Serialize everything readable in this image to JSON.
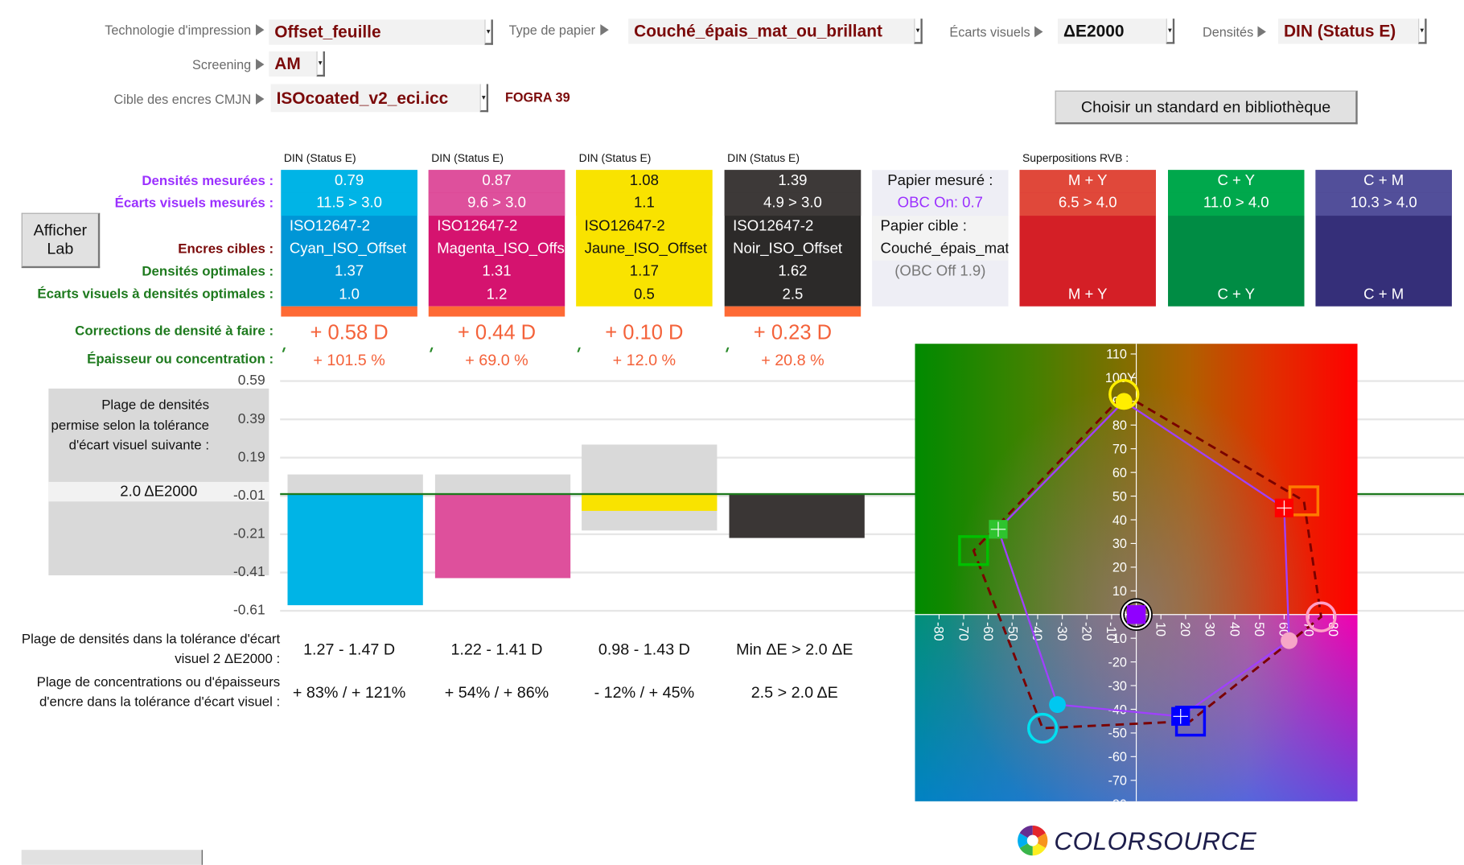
{
  "settings": {
    "technology": {
      "label": "Technologie d'impression",
      "value": "Offset_feuille"
    },
    "paper_type": {
      "label": "Type de papier",
      "value": "Couché_épais_mat_ou_brillant"
    },
    "visual_diff": {
      "label": "Écarts visuels",
      "value": "ΔE2000"
    },
    "densities": {
      "label": "Densités",
      "value": "DIN (Status E)"
    },
    "screening": {
      "label": "Screening",
      "value": "AM"
    },
    "target": {
      "label": "Cible des encres CMJN",
      "value": "ISOcoated_v2_eci.icc",
      "note": "FOGRA 39"
    },
    "library_button": "Choisir un standard en bibliothèque"
  },
  "show_lab_button": "Afficher Lab",
  "row_labels": {
    "measured_density": "Densités mesurées :",
    "measured_de": "Écarts visuels mesurés :",
    "target_inks": "Encres cibles :",
    "optimal_density": "Densités optimales :",
    "optimal_de": "Écarts visuels à densités optimales :",
    "corrections": "Corrections de densité à faire :",
    "thickness": "Épaisseur ou concentration :",
    "density_range": "Plage de densités dans la tolérance d'écart visuel 2 ΔE2000 :",
    "concentration_range": "Plage de concentrations ou d'épaisseurs d'encre dans la tolérance d'écart visuel :"
  },
  "inks": [
    {
      "header": "DIN (Status E)",
      "measured_density": "0.79",
      "measured_de": "11.5 > 3.0",
      "standard": "ISO12647-2",
      "ink_name": "Cyan_ISO_Offset",
      "optimal_density": "1.37",
      "optimal_de": "1.0",
      "correction": "+ 0.58 D",
      "thickness": "+ 101.5 %",
      "density_range": "1.27 - 1.47 D",
      "concentration_range": "+ 83% / + 121%",
      "color_top": "#00b4e6",
      "color_bottom": "#0096d6",
      "text_color": "#ffffff",
      "out_of_tolerance": true
    },
    {
      "header": "DIN (Status E)",
      "measured_density": "0.87",
      "measured_de": "9.6 > 3.0",
      "standard": "ISO12647-2",
      "ink_name": "Magenta_ISO_Offset",
      "optimal_density": "1.31",
      "optimal_de": "1.2",
      "correction": "+ 0.44 D",
      "thickness": "+ 69.0 %",
      "density_range": "1.22 - 1.41 D",
      "concentration_range": "+ 54% / + 86%",
      "color_top": "#de509c",
      "color_bottom": "#d5136f",
      "text_color": "#ffffff",
      "out_of_tolerance": true
    },
    {
      "header": "DIN (Status E)",
      "measured_density": "1.08",
      "measured_de": "1.1",
      "standard": "ISO12647-2",
      "ink_name": "Jaune_ISO_Offset",
      "optimal_density": "1.17",
      "optimal_de": "0.5",
      "correction": "+ 0.10 D",
      "thickness": "+ 12.0 %",
      "density_range": "0.98 - 1.43 D",
      "concentration_range": "- 12% / + 45%",
      "color_top": "#f9e300",
      "color_bottom": "#f9e300",
      "text_color": "#111111",
      "out_of_tolerance": false
    },
    {
      "header": "DIN (Status E)",
      "measured_density": "1.39",
      "measured_de": "4.9 > 3.0",
      "standard": "ISO12647-2",
      "ink_name": "Noir_ISO_Offset",
      "optimal_density": "1.62",
      "optimal_de": "2.5",
      "correction": "+ 0.23 D",
      "thickness": "+ 20.8 %",
      "density_range": "Min ΔE > 2.0 ΔE",
      "concentration_range": "2.5 > 2.0 ΔE",
      "color_top": "#3d3938",
      "color_bottom": "#2c2a29",
      "text_color": "#ffffff",
      "out_of_tolerance": true
    }
  ],
  "paper": {
    "measured_label": "Papier mesuré :",
    "measured_value": "OBC On: 0.7",
    "target_label": "Papier cible :",
    "target_value": "Couché_épais_mat_ou_brillant",
    "target_note": "(OBC Off 1.9)"
  },
  "overlays": {
    "title": "Superpositions RVB :",
    "items": [
      {
        "name": "M + Y",
        "de": "6.5 > 4.0",
        "color_top": "#e0483a",
        "color_bottom": "#d41f26"
      },
      {
        "name": "C + Y",
        "de": "11.0 > 4.0",
        "color_top": "#00a84c",
        "color_bottom": "#008c44"
      },
      {
        "name": "C + M",
        "de": "10.3 > 4.0",
        "color_top": "#524f9a",
        "color_bottom": "#352f79"
      }
    ]
  },
  "tolerance_box": {
    "text": "Plage de densités permise selon la tolérance d'écart visuel suivante :",
    "value": "2.0 ΔE2000"
  },
  "chart_data": [
    {
      "type": "bar",
      "categories": [
        "Cyan",
        "Magenta",
        "Jaune",
        "Noir"
      ],
      "series": [
        {
          "values": [
            -0.58,
            -0.44,
            -0.09,
            -0.23
          ],
          "colors": [
            "#00b4e6",
            "#de509c",
            "#f9e300",
            "#3a3635"
          ]
        }
      ],
      "tolerance_bands": [
        [
          -0.1,
          0.1
        ],
        [
          -0.09,
          0.1
        ],
        [
          -0.19,
          0.26
        ],
        null
      ],
      "band_color": "#d9d9d9",
      "reference_line": 0,
      "reference_color": "#1e7a1e",
      "yticks": [
        "0.59",
        "0.39",
        "0.19",
        "-0.01",
        "-0.21",
        "-0.41",
        "-0.61"
      ],
      "ylim": [
        -0.61,
        0.59
      ],
      "grid": true
    },
    {
      "type": "scatter",
      "xlim": [
        -90,
        90
      ],
      "ylim": [
        -80,
        115
      ],
      "xticks": [
        -80,
        -70,
        -60,
        -50,
        -40,
        -30,
        -20,
        -10,
        10,
        20,
        30,
        40,
        50,
        60,
        70,
        80
      ],
      "yticks": [
        110,
        100,
        90,
        80,
        70,
        60,
        50,
        40,
        30,
        20,
        10,
        0,
        -10,
        -20,
        -30,
        -40,
        -50,
        -60,
        -70,
        -80
      ],
      "axis_label_y": "Y",
      "measured": [
        {
          "ink": "Y",
          "a": -5,
          "b": 90,
          "color": "#ffee00",
          "marker": "circle"
        },
        {
          "ink": "R",
          "a": 60,
          "b": 45,
          "color": "#ff0000",
          "marker": "square"
        },
        {
          "ink": "M",
          "a": 62,
          "b": -11,
          "color": "#f7a6c8",
          "marker": "circle"
        },
        {
          "ink": "B",
          "a": 18,
          "b": -43,
          "color": "#0000ff",
          "marker": "square"
        },
        {
          "ink": "C",
          "a": -32,
          "b": -38,
          "color": "#00c8f0",
          "marker": "circle"
        },
        {
          "ink": "G",
          "a": -56,
          "b": 36,
          "color": "#2ec42e",
          "marker": "square"
        }
      ],
      "targets": [
        {
          "ink": "Y",
          "a": -5,
          "b": 93,
          "color": "#ffee00",
          "marker": "circle"
        },
        {
          "ink": "R",
          "a": 68,
          "b": 48,
          "color": "#ff7a00",
          "marker": "square"
        },
        {
          "ink": "M",
          "a": 75,
          "b": -1,
          "color": "#ffa0c8",
          "marker": "circle"
        },
        {
          "ink": "B",
          "a": 22,
          "b": -45,
          "color": "#0000ff",
          "marker": "square"
        },
        {
          "ink": "C",
          "a": -38,
          "b": -48,
          "color": "#00e0f0",
          "marker": "circle"
        },
        {
          "ink": "G",
          "a": -66,
          "b": 27,
          "color": "#00c000",
          "marker": "square"
        }
      ],
      "paper": {
        "a": 0,
        "b": 0,
        "color": "#9000ff"
      },
      "measured_line_color": "#a040ff",
      "target_line_color": "#7a0000"
    }
  ],
  "logo": {
    "text": "COLORSOURCE"
  }
}
